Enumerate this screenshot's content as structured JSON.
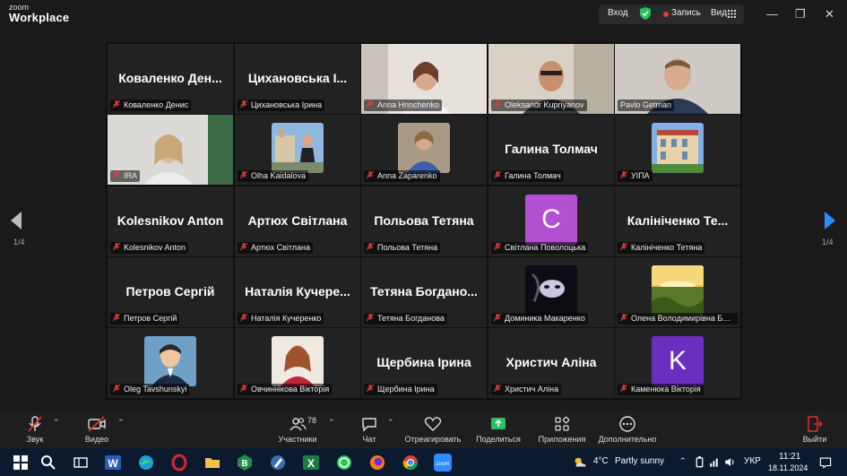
{
  "app": {
    "logo_line1": "zoom",
    "logo_line2": "Workplace"
  },
  "topbar": {
    "enter": "Вход",
    "record": "Запись",
    "view": "Вид"
  },
  "colors": {
    "active_speaker": "#35d17a",
    "record_red": "#e03b3b",
    "share_green": "#27c25f",
    "leave_red": "#e02d2d",
    "nav_blue": "#2d8cff"
  },
  "pagination": {
    "left": "1/4",
    "right": "1/4"
  },
  "tiles": [
    {
      "name": "Коваленко Денис",
      "big": "Коваленко Ден...",
      "type": "name"
    },
    {
      "name": "Цихановська Ірина",
      "big": "Цихановська І...",
      "type": "name"
    },
    {
      "name": "Anna Hrinchenko",
      "type": "video"
    },
    {
      "name": "Oleksandr Kupriyanov",
      "type": "video"
    },
    {
      "name": "Pavlo Getman",
      "type": "video",
      "active": true
    },
    {
      "name": "IRA",
      "type": "video"
    },
    {
      "name": "Olha Kaidalova",
      "type": "photo"
    },
    {
      "name": "Anna Zaparenko",
      "type": "photo"
    },
    {
      "name": "Галина Толмач",
      "big": "Галина Толмач",
      "type": "name"
    },
    {
      "name": "УІПА",
      "type": "photo"
    },
    {
      "name": "Kolesnikov Anton",
      "big": "Kolesnikov Anton",
      "type": "name"
    },
    {
      "name": "Артюх Світлана",
      "big": "Артюх Світлана",
      "type": "name"
    },
    {
      "name": "Польова Тетяна",
      "big": "Польова Тетяна",
      "type": "name"
    },
    {
      "name": "Світлана Поволоцька",
      "type": "letter",
      "letter": "C",
      "color": "#b34fd1"
    },
    {
      "name": "Калініченко Тетяна",
      "big": "Калініченко Те...",
      "type": "name"
    },
    {
      "name": "Петров Сергій",
      "big": "Петров Сергій",
      "type": "name"
    },
    {
      "name": "Наталія Кучеренко",
      "big": "Наталія Кучере...",
      "type": "name"
    },
    {
      "name": "Тетяна Богданова",
      "big": "Тетяна Богдано...",
      "type": "name"
    },
    {
      "name": "Доминика Макаренко",
      "type": "photo"
    },
    {
      "name": "Олена Володимирівна Баб...",
      "type": "photo"
    },
    {
      "name": "Oleg Tavshunskyi",
      "type": "photo"
    },
    {
      "name": "Овчиннікова Вікторія",
      "type": "photo"
    },
    {
      "name": "Щербина Ірина",
      "big": "Щербина Ірина",
      "type": "name"
    },
    {
      "name": "Христич Аліна",
      "big": "Христич Аліна",
      "type": "name"
    },
    {
      "name": "Каменюка Вікторія",
      "type": "letter",
      "letter": "K",
      "color": "#6a2fc0"
    }
  ],
  "toolbar": {
    "audio": "Звук",
    "video": "Видео",
    "participants": "Участники",
    "participants_count": "78",
    "chat": "Чат",
    "react": "Отреагировать",
    "share": "Поделиться",
    "apps": "Приложения",
    "more": "Дополнительно",
    "leave": "Выйти"
  },
  "taskbar": {
    "weather": "4°C",
    "weather_text": "Partly sunny",
    "lang": "УКР",
    "time": "11:21",
    "date": "18.11.2024"
  }
}
